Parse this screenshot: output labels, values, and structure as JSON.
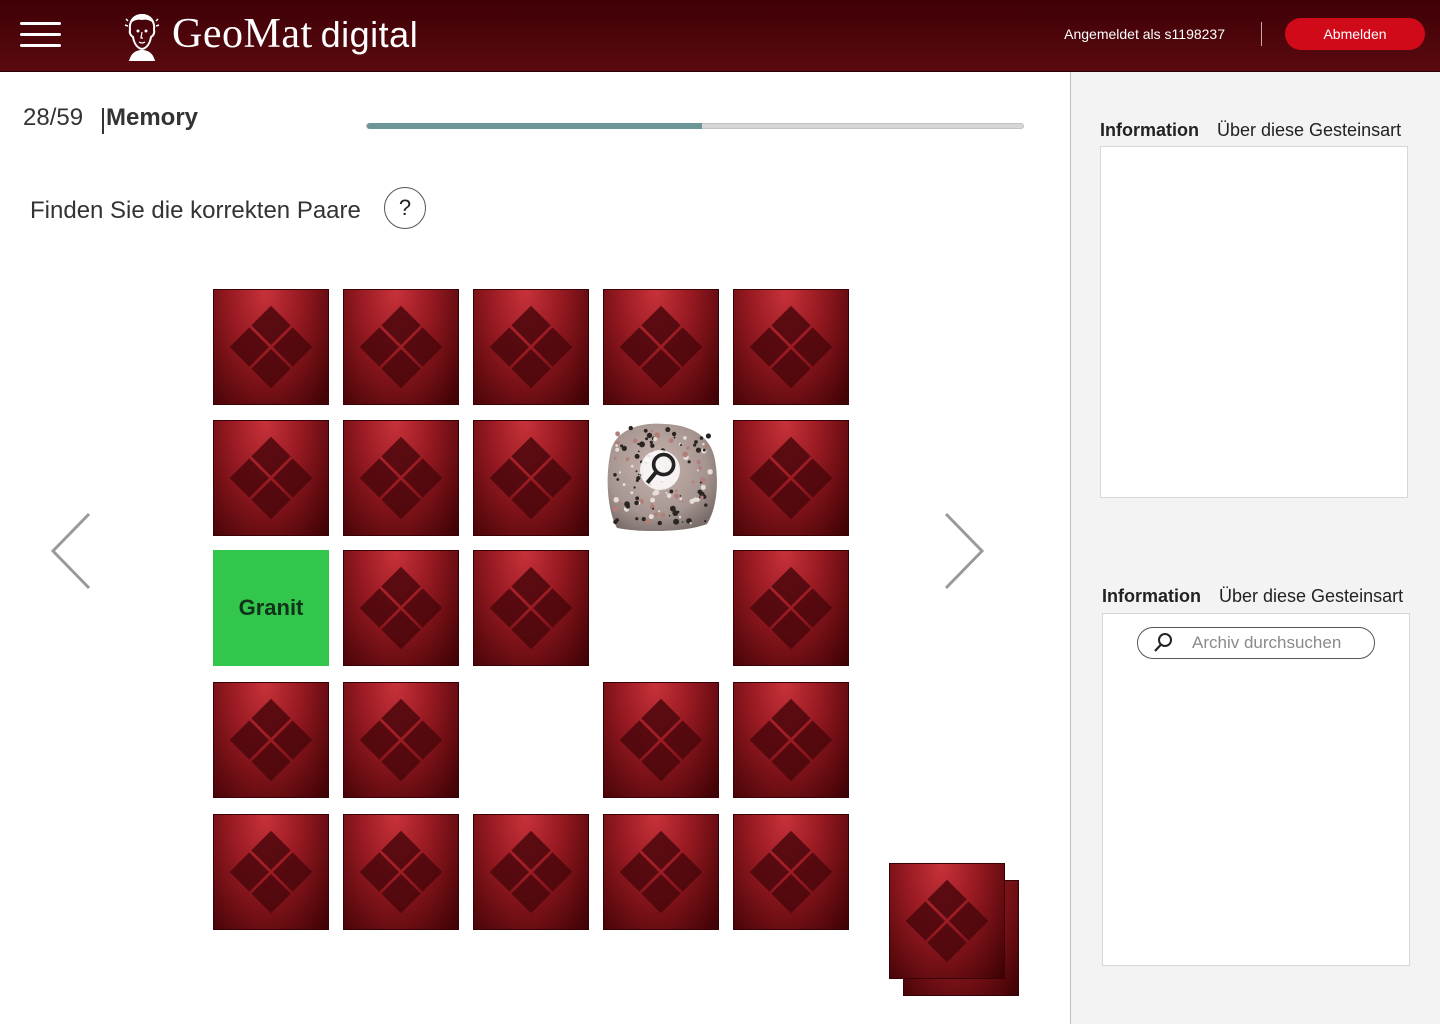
{
  "header": {
    "brand_main": "GeoMat",
    "brand_sub": "digital",
    "logged_in_text": "Angemeldet als s1198237",
    "logout_label": "Abmelden"
  },
  "quiz": {
    "position": "28/59",
    "mode": "Memory",
    "progress": 0.51,
    "instruction": "Finden Sie die korrekten Paare",
    "help_label": "?"
  },
  "board": {
    "rows": [
      [
        "back",
        "back",
        "back",
        "back",
        "back"
      ],
      [
        "back",
        "back",
        "back",
        "photo",
        "back"
      ],
      [
        "matched",
        "back",
        "back",
        "empty",
        "back"
      ],
      [
        "back",
        "back",
        "empty",
        "back",
        "back"
      ],
      [
        "back",
        "back",
        "back",
        "back",
        "back"
      ]
    ],
    "matched_label": "Granit",
    "photo_subject": "granite rock sample",
    "deck_cards": 2
  },
  "panels": [
    {
      "tab_info": "Information",
      "tab_about": "Über diese Gesteinsart"
    },
    {
      "tab_info": "Information",
      "tab_about": "Über diese Gesteinsart",
      "search_placeholder": "Archiv durchsuchen"
    }
  ],
  "colors": {
    "header_bg": "#4a060b",
    "logout_bg": "#d10a1a",
    "card_back": "#981a22",
    "matched": "#33c64c",
    "progress": "#6c9597"
  }
}
